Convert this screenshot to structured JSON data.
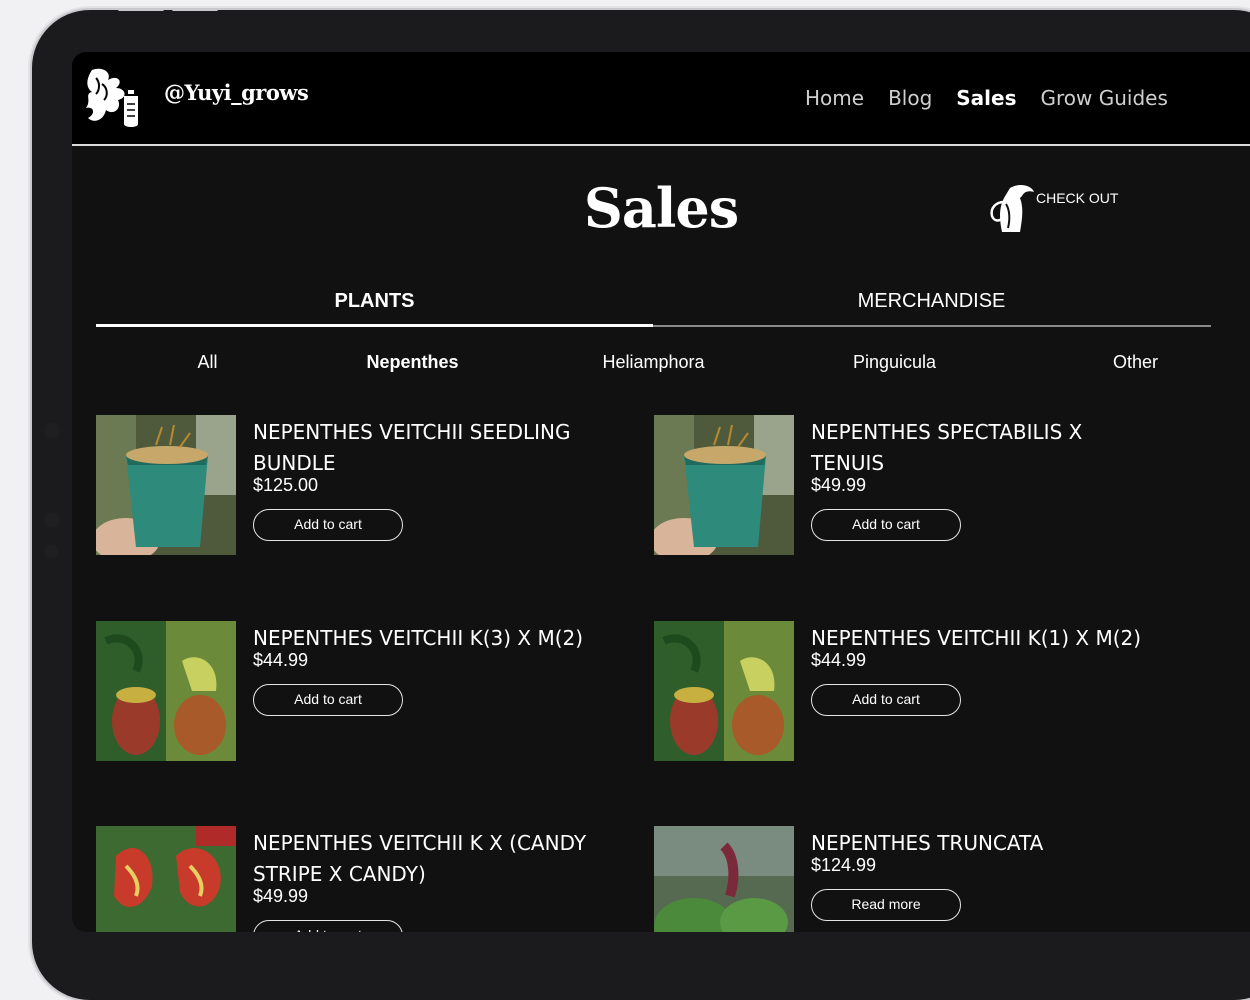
{
  "site": {
    "brand": "@Yuyi_grows",
    "nav": [
      "Home",
      "Blog",
      "Sales",
      "Grow Guides"
    ]
  },
  "page": {
    "title": "Sales",
    "checkout_label": "CHECK OUT"
  },
  "tabs": [
    "PLANTS",
    "MERCHANDISE"
  ],
  "filters": [
    "All",
    "Nepenthes",
    "Heliamphora",
    "Pinguicula",
    "Other"
  ],
  "products": [
    {
      "name": "NEPENTHES VEITCHII SEEDLING BUNDLE",
      "price": "$125.00",
      "button": "Add to cart"
    },
    {
      "name": "NEPENTHES SPECTABILIS X TENUIS",
      "price": "$49.99",
      "button": "Add to cart"
    },
    {
      "name": "NEPENTHES VEITCHII K(3) X M(2)",
      "price": "$44.99",
      "button": "Add to cart"
    },
    {
      "name": "NEPENTHES VEITCHII K(1) X M(2)",
      "price": "$44.99",
      "button": "Add to cart"
    },
    {
      "name": "NEPENTHES VEITCHII K X (CANDY STRIPE X CANDY)",
      "price": "$49.99",
      "button": "Add to cart"
    },
    {
      "name": "NEPENTHES TRUNCATA",
      "price": "$124.99",
      "button": "Read more"
    }
  ]
}
